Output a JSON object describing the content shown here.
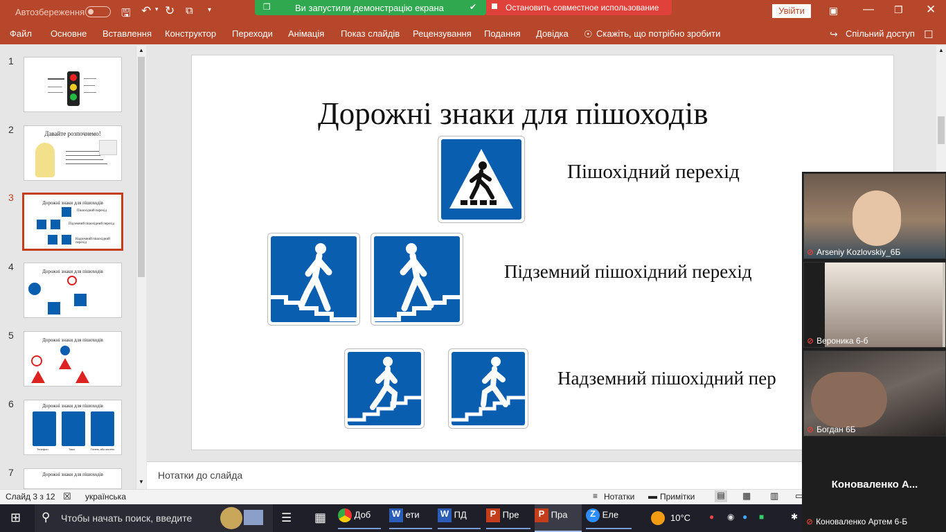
{
  "titlebar": {
    "autosave": "Автозбереження",
    "share_banner": "Ви запустили демонстрацію екрана",
    "stop_share": "Остановить совместное использование",
    "signin": "Увійти"
  },
  "ribbon": {
    "tabs": [
      "Файл",
      "Основне",
      "Вставлення",
      "Конструктор",
      "Переходи",
      "Анімація",
      "Показ слайдів",
      "Рецензування",
      "Подання",
      "Довідка"
    ],
    "tell_me": "Скажіть, що потрібно зробити",
    "share": "Спільний доступ"
  },
  "thumbnails": {
    "numbers": [
      "1",
      "2",
      "3",
      "4",
      "5",
      "6",
      "7"
    ],
    "t2_title": "Давайте розпочнемо!",
    "t3_title": "Дорожні знаки для пішоходів",
    "t3_l1": "Пішохідний перехід",
    "t3_l2": "Підземний пішохідний перехід",
    "t3_l3": "Надземний пішохідний перехід",
    "t4_title": "Дорожні знаки для пішоходів",
    "t5_title": "Дорожні знаки для пішоходів",
    "t6_title": "Дорожні знаки для пішоходів",
    "t6_labels": [
      "Телефон",
      "Таксі",
      "Готель або мотель"
    ],
    "t7_title": "Дорожні знаки для пішоходів"
  },
  "slide": {
    "title": "Дорожні знаки для пішоходів",
    "label1": "Пішохідний перехід",
    "label2": "Підземний пішохідний перехід",
    "label3": "Надземний пішохідний пер"
  },
  "notes": {
    "placeholder": "Нотатки до слайда"
  },
  "status": {
    "slide_of": "Слайд 3 з 12",
    "language": "українська",
    "notes": "Нотатки",
    "comments": "Примітки"
  },
  "taskbar": {
    "search": "Чтобы начать поиск, введите",
    "apps": [
      "Доб",
      "ети",
      "ПД",
      "Пре",
      "Пра",
      "Еле"
    ],
    "weather": "10°C"
  },
  "video": {
    "participants": [
      "Arseniy Kozlovskiy_6Б",
      "Вероника 6-б",
      "Богдан 6Б",
      "Коноваленко А...",
      "Коноваленко Артем 6-Б"
    ]
  },
  "colors": {
    "brand": "#b7472a",
    "sign_blue": "#0a5eb0",
    "banner_green": "#2fa84f",
    "banner_red": "#e0413a"
  }
}
